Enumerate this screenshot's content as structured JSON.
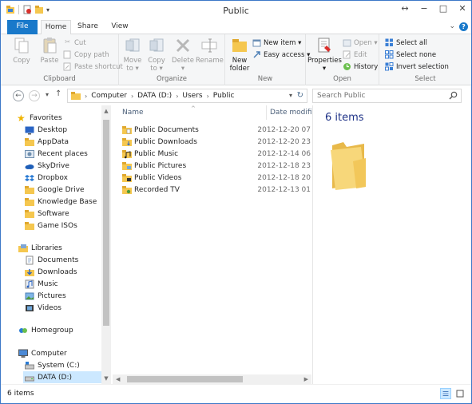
{
  "window": {
    "title": "Public"
  },
  "window_buttons": {
    "minimize": "−",
    "maximize": "□",
    "close": "✕",
    "resize": "↔"
  },
  "ribbon_tabs": {
    "file": "File",
    "home": "Home",
    "share": "Share",
    "view": "View"
  },
  "ribbon": {
    "clipboard": {
      "label": "Clipboard",
      "copy": "Copy",
      "paste": "Paste",
      "cut": "Cut",
      "copy_path": "Copy path",
      "paste_shortcut": "Paste shortcut"
    },
    "organize": {
      "label": "Organize",
      "move_to": "Move",
      "move_to_2": "to ▾",
      "copy_to": "Copy",
      "copy_to_2": "to ▾",
      "delete": "Delete",
      "delete_2": "▾",
      "rename": "Rename"
    },
    "new": {
      "label": "New",
      "new_folder": "New",
      "new_folder_2": "folder",
      "new_item": "New item ▾",
      "easy_access": "Easy access ▾"
    },
    "open": {
      "label": "Open",
      "properties": "Properties",
      "properties_2": "▾",
      "open": "Open ▾",
      "edit": "Edit",
      "history": "History"
    },
    "select": {
      "label": "Select",
      "select_all": "Select all",
      "select_none": "Select none",
      "invert": "Invert selection"
    }
  },
  "address": {
    "crumbs": [
      "Computer",
      "DATA (D:)",
      "Users",
      "Public"
    ],
    "search_placeholder": "Search Public"
  },
  "nav": {
    "favorites": "Favorites",
    "fav_items": [
      "Desktop",
      "AppData",
      "Recent places",
      "SkyDrive",
      "Dropbox",
      "Google Drive",
      "Knowledge Base",
      "Software",
      "Game ISOs"
    ],
    "libraries": "Libraries",
    "lib_items": [
      "Documents",
      "Downloads",
      "Music",
      "Pictures",
      "Videos"
    ],
    "homegroup": "Homegroup",
    "computer": "Computer",
    "drives": [
      "System (C:)",
      "DATA (D:)"
    ]
  },
  "files": {
    "headers": {
      "name": "Name",
      "date": "Date modified"
    },
    "rows": [
      {
        "name": "Public Documents",
        "date": "2012-12-20 07"
      },
      {
        "name": "Public Downloads",
        "date": "2012-12-20 23"
      },
      {
        "name": "Public Music",
        "date": "2012-12-14 06"
      },
      {
        "name": "Public Pictures",
        "date": "2012-12-18 23"
      },
      {
        "name": "Public Videos",
        "date": "2012-12-18 20"
      },
      {
        "name": "Recorded TV",
        "date": "2012-12-13 01"
      }
    ]
  },
  "preview": {
    "count": "6 items"
  },
  "status": {
    "count": "6 items"
  },
  "colors": {
    "accent": "#1979ca",
    "folder": "#f5c74f",
    "selection": "#cce8ff"
  }
}
